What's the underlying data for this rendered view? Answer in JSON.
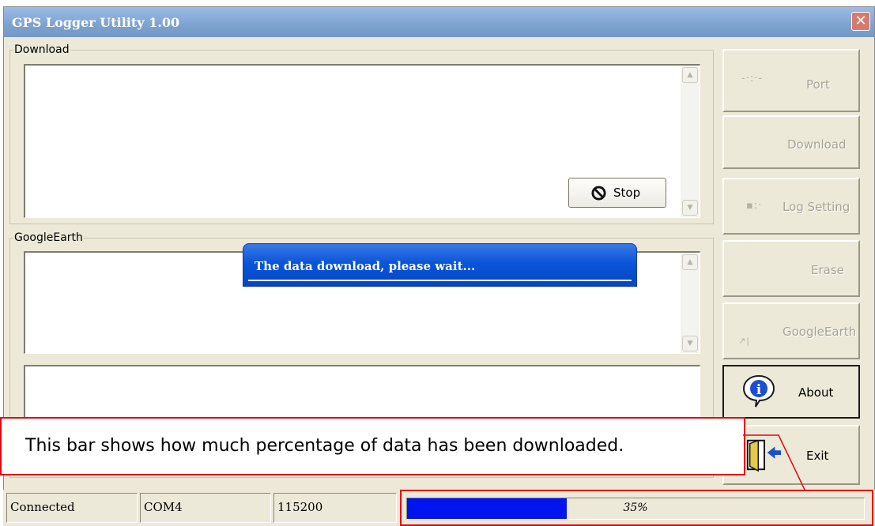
{
  "window": {
    "title": "GPS Logger Utility 1.00"
  },
  "groups": {
    "download_label": "Download",
    "googleearth_label": "GoogleEarth"
  },
  "stop_button": {
    "label": "Stop"
  },
  "buttons": [
    {
      "label": "Port",
      "enabled": false
    },
    {
      "label": "Download",
      "enabled": false
    },
    {
      "label": "Log Setting",
      "enabled": false
    },
    {
      "label": "Erase",
      "enabled": false
    },
    {
      "label": "GoogleEarth",
      "enabled": false
    },
    {
      "label": "About",
      "enabled": true
    },
    {
      "label": "Exit",
      "enabled": true
    }
  ],
  "dialog": {
    "message": "The data download, please wait..."
  },
  "status_bar": {
    "connection": "Connected",
    "port": "COM4",
    "baud": "115200"
  },
  "progress": {
    "value": 0.35,
    "text": "35%"
  },
  "callout": {
    "text": "This bar shows how much percentage of data has been downloaded."
  },
  "colors": {
    "progress_fill": "#0014f0",
    "annotation": "#e30613",
    "dialog": "#0b55d8"
  }
}
